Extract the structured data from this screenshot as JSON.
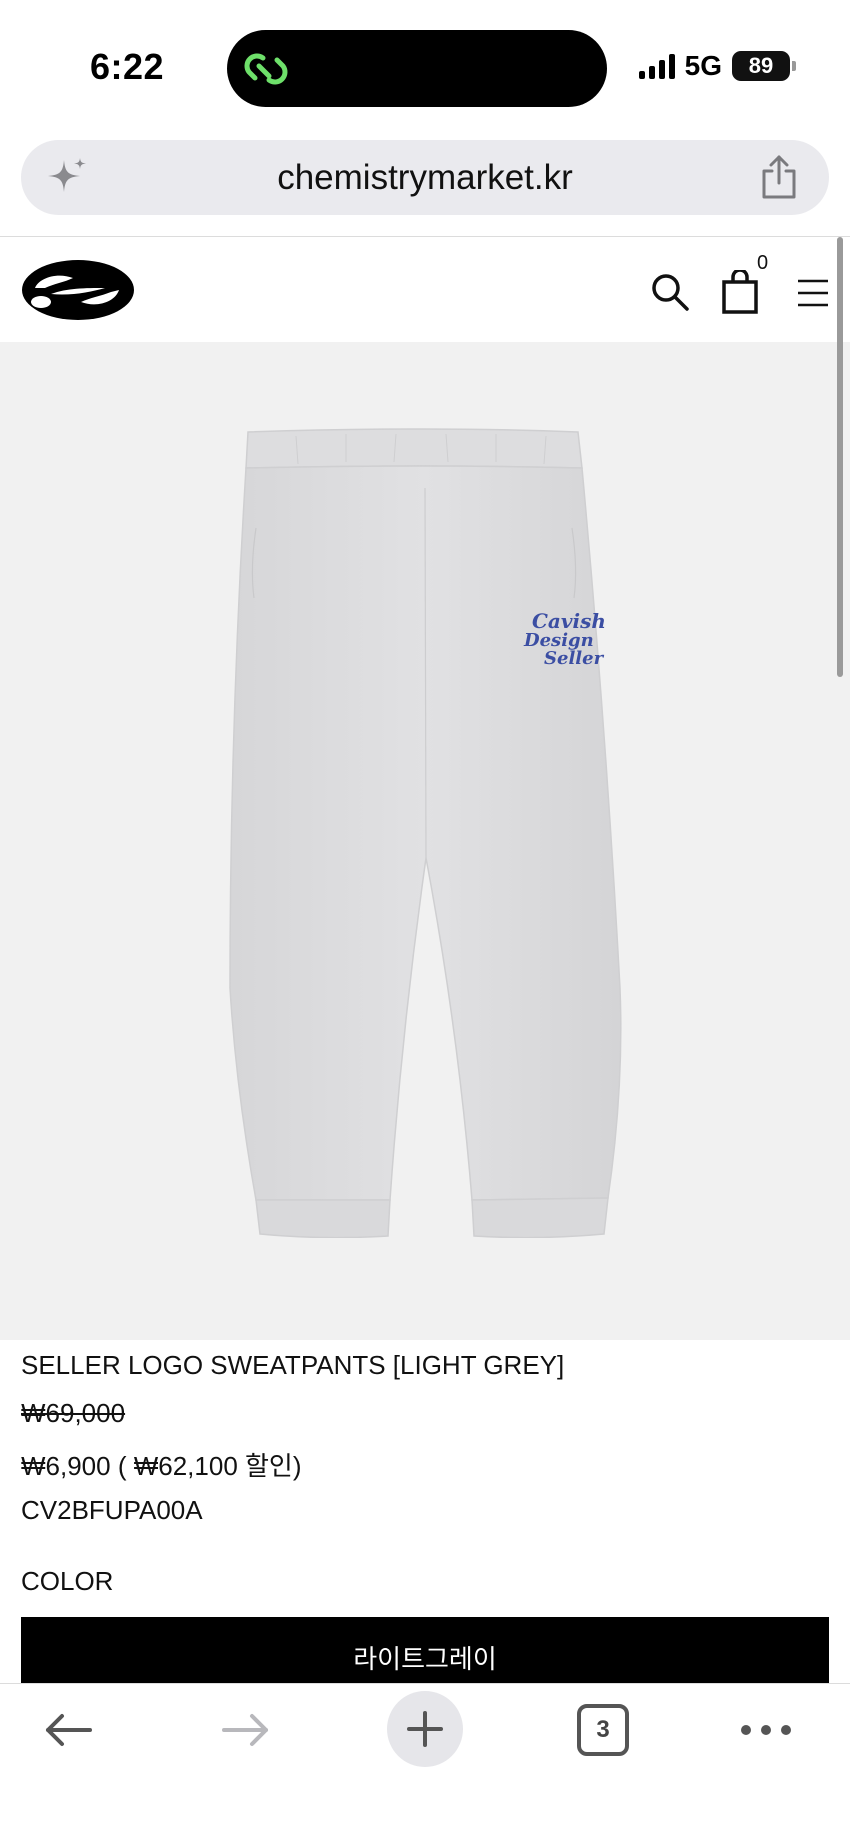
{
  "status_bar": {
    "time": "6:22",
    "network": "5G",
    "battery": "89"
  },
  "browser": {
    "url": "chemistrymarket.kr",
    "tab_count": "3",
    "icons": [
      "sparkle-icon",
      "share-icon",
      "back-arrow-icon",
      "forward-arrow-icon",
      "plus-icon",
      "tabs-icon",
      "more-icon"
    ]
  },
  "site_header": {
    "cart_count": "0",
    "icons": [
      "logo",
      "search-icon",
      "shopping-bag-icon",
      "menu-icon"
    ]
  },
  "product": {
    "title": "SELLER LOGO SWEATPANTS [LIGHT GREY]",
    "original_price": "₩69,000",
    "sale_price": "₩6,900 ( ₩62,100 할인)",
    "code": "CV2BFUPA00A",
    "color_label": "COLOR",
    "color_option": "라이트그레이",
    "image_logo_text": [
      "Cavish",
      "Design",
      "Seller"
    ]
  },
  "colors": {
    "image_background": "#f1f1f1",
    "pants": "#dcdcde",
    "print_logo": "#3b4ea3",
    "island_icon": "#6ee06a"
  }
}
